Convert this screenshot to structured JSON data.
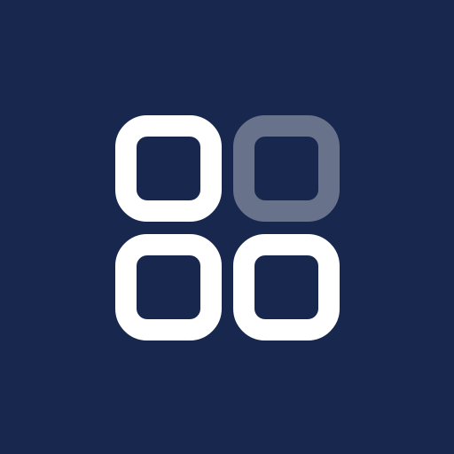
{
  "icon": {
    "name": "app-grid-icon",
    "background_color": "#18274d",
    "tile_color": "#ffffff",
    "tile_faded_opacity": 0.35,
    "tiles": [
      {
        "name": "tile-top-left",
        "state": "solid"
      },
      {
        "name": "tile-top-right",
        "state": "faded"
      },
      {
        "name": "tile-bottom-left",
        "state": "solid"
      },
      {
        "name": "tile-bottom-right",
        "state": "solid"
      }
    ]
  }
}
